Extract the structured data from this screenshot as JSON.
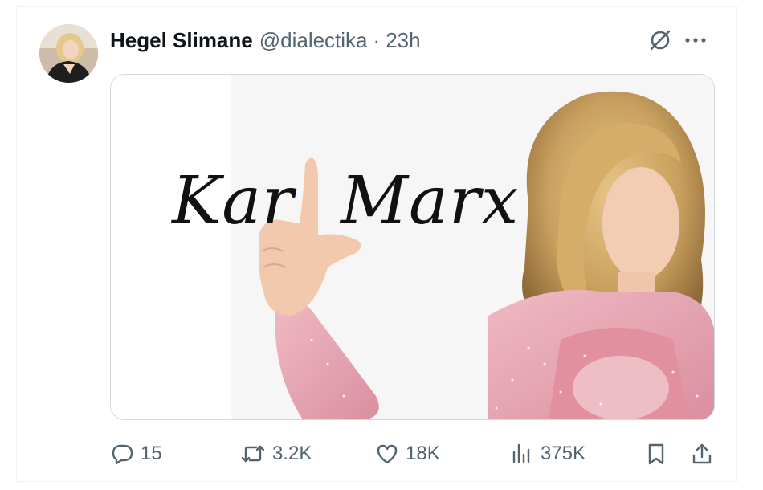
{
  "tweet": {
    "author": {
      "display_name": "Hegel Slimane",
      "handle": "@dialectika",
      "avatar_icon": "profile-photo"
    },
    "separator": "·",
    "time": "23h",
    "media": {
      "text_left": "Kar",
      "text_right": "Marx"
    },
    "actions": {
      "replies": "15",
      "retweets": "3.2K",
      "likes": "18K",
      "views": "375K"
    },
    "icons": {
      "grok": "slashed-circle-icon",
      "more": "more-dots-icon",
      "reply": "speech-bubble-icon",
      "retweet": "retweet-arrows-icon",
      "like": "heart-icon",
      "views": "bar-chart-icon",
      "bookmark": "bookmark-icon",
      "share": "share-icon"
    },
    "colors": {
      "text": "#0f1419",
      "secondary": "#536471",
      "border": "#cfd9de"
    }
  }
}
